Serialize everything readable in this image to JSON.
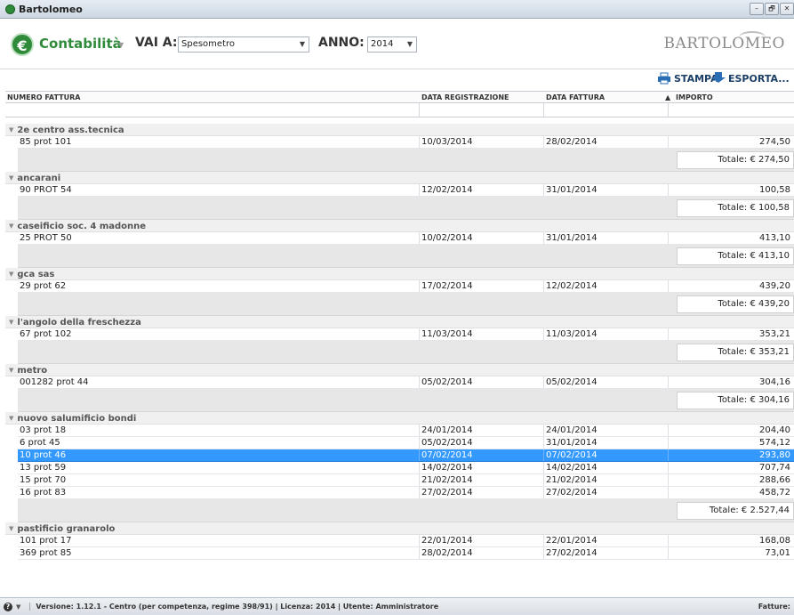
{
  "window": {
    "title": "Bartolomeo",
    "buttons": [
      "–",
      "🗗",
      "✕"
    ]
  },
  "header": {
    "module": "Contabilità",
    "vai_label": "VAI A:",
    "vai_value": "Spesometro",
    "anno_label": "ANNO:",
    "anno_value": "2014",
    "brand": "BARTOLOMEO"
  },
  "toolbar": {
    "print_label": "STAMPA",
    "export_label": "ESPORTA..."
  },
  "columns": {
    "numero": "NUMERO FATTURA",
    "registrazione": "DATA REGISTRAZIONE",
    "fattura": "DATA FATTURA",
    "importo": "IMPORTO",
    "sort_indicator": "▲"
  },
  "groups": [
    {
      "name": "2e centro ass.tecnica",
      "total": "Totale: € 274,50",
      "rows": [
        {
          "numero": "85 prot 101",
          "reg": "10/03/2014",
          "fatt": "28/02/2014",
          "imp": "274,50"
        }
      ]
    },
    {
      "name": "ancarani",
      "total": "Totale: € 100,58",
      "rows": [
        {
          "numero": "90 PROT 54",
          "reg": "12/02/2014",
          "fatt": "31/01/2014",
          "imp": "100,58"
        }
      ]
    },
    {
      "name": "caseificio soc. 4 madonne",
      "total": "Totale: € 413,10",
      "rows": [
        {
          "numero": "25 PROT 50",
          "reg": "10/02/2014",
          "fatt": "31/01/2014",
          "imp": "413,10"
        }
      ]
    },
    {
      "name": "gca sas",
      "total": "Totale: € 439,20",
      "rows": [
        {
          "numero": "29 prot 62",
          "reg": "17/02/2014",
          "fatt": "12/02/2014",
          "imp": "439,20"
        }
      ]
    },
    {
      "name": "l'angolo della freschezza",
      "total": "Totale: € 353,21",
      "rows": [
        {
          "numero": "67 prot 102",
          "reg": "11/03/2014",
          "fatt": "11/03/2014",
          "imp": "353,21"
        }
      ]
    },
    {
      "name": "metro",
      "total": "Totale: € 304,16",
      "rows": [
        {
          "numero": "001282 prot 44",
          "reg": "05/02/2014",
          "fatt": "05/02/2014",
          "imp": "304,16"
        }
      ]
    },
    {
      "name": "nuovo salumificio bondi",
      "total": "Totale: € 2.527,44",
      "rows": [
        {
          "numero": "03 prot 18",
          "reg": "24/01/2014",
          "fatt": "24/01/2014",
          "imp": "204,40"
        },
        {
          "numero": "6 prot 45",
          "reg": "05/02/2014",
          "fatt": "31/01/2014",
          "imp": "574,12"
        },
        {
          "numero": "10 prot 46",
          "reg": "07/02/2014",
          "fatt": "07/02/2014",
          "imp": "293,80",
          "selected": true
        },
        {
          "numero": "13 prot 59",
          "reg": "14/02/2014",
          "fatt": "14/02/2014",
          "imp": "707,74"
        },
        {
          "numero": "15 prot 70",
          "reg": "21/02/2014",
          "fatt": "21/02/2014",
          "imp": "288,66"
        },
        {
          "numero": "16 prot 83",
          "reg": "27/02/2014",
          "fatt": "27/02/2014",
          "imp": "458,72"
        }
      ]
    },
    {
      "name": "pastificio granarolo",
      "total": "",
      "rows": [
        {
          "numero": "101 prot 17",
          "reg": "22/01/2014",
          "fatt": "22/01/2014",
          "imp": "168,08"
        },
        {
          "numero": "369 prot 85",
          "reg": "28/02/2014",
          "fatt": "27/02/2014",
          "imp": "73,01"
        }
      ]
    }
  ],
  "status": {
    "text": "Versione: 1.12.1 - Centro (per competenza, regime 398/91) | Licenza: 2014 | Utente: Amministratore",
    "right": "Fatture:"
  },
  "colors": {
    "accent": "#2f8a3a",
    "selection": "#3399ff",
    "toolbar_text": "#1b3f66"
  }
}
